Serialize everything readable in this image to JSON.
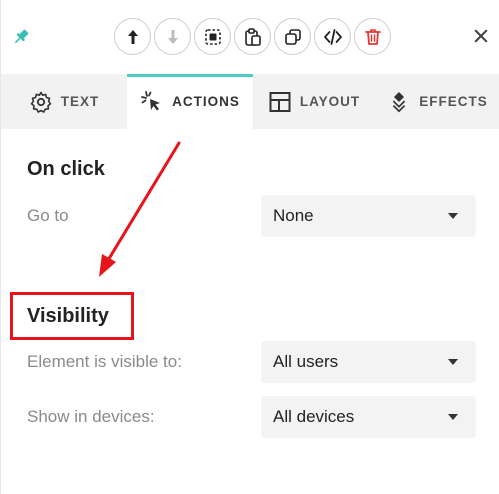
{
  "toolbar": {
    "tools": [
      {
        "icon": "move-up-icon"
      },
      {
        "icon": "move-down-icon"
      },
      {
        "icon": "select-icon"
      },
      {
        "icon": "paste-icon"
      },
      {
        "icon": "duplicate-icon"
      },
      {
        "icon": "code-icon"
      },
      {
        "icon": "delete-icon"
      }
    ],
    "close_glyph": "×"
  },
  "tabs": [
    {
      "label": "TEXT",
      "icon": "gear-icon",
      "active": false
    },
    {
      "label": "ACTIONS",
      "icon": "cursor-click-icon",
      "active": true
    },
    {
      "label": "LAYOUT",
      "icon": "layout-icon",
      "active": false
    },
    {
      "label": "EFFECTS",
      "icon": "layers-icon",
      "active": false
    }
  ],
  "on_click": {
    "title": "On click",
    "goto_label": "Go to",
    "goto_value": "None"
  },
  "visibility": {
    "title": "Visibility",
    "visible_to_label": "Element is visible to:",
    "visible_to_value": "All users",
    "devices_label": "Show in devices:",
    "devices_value": "All devices"
  },
  "colors": {
    "accent": "#4ecdc4",
    "annotation": "#e8141b",
    "delete": "#e53935"
  }
}
